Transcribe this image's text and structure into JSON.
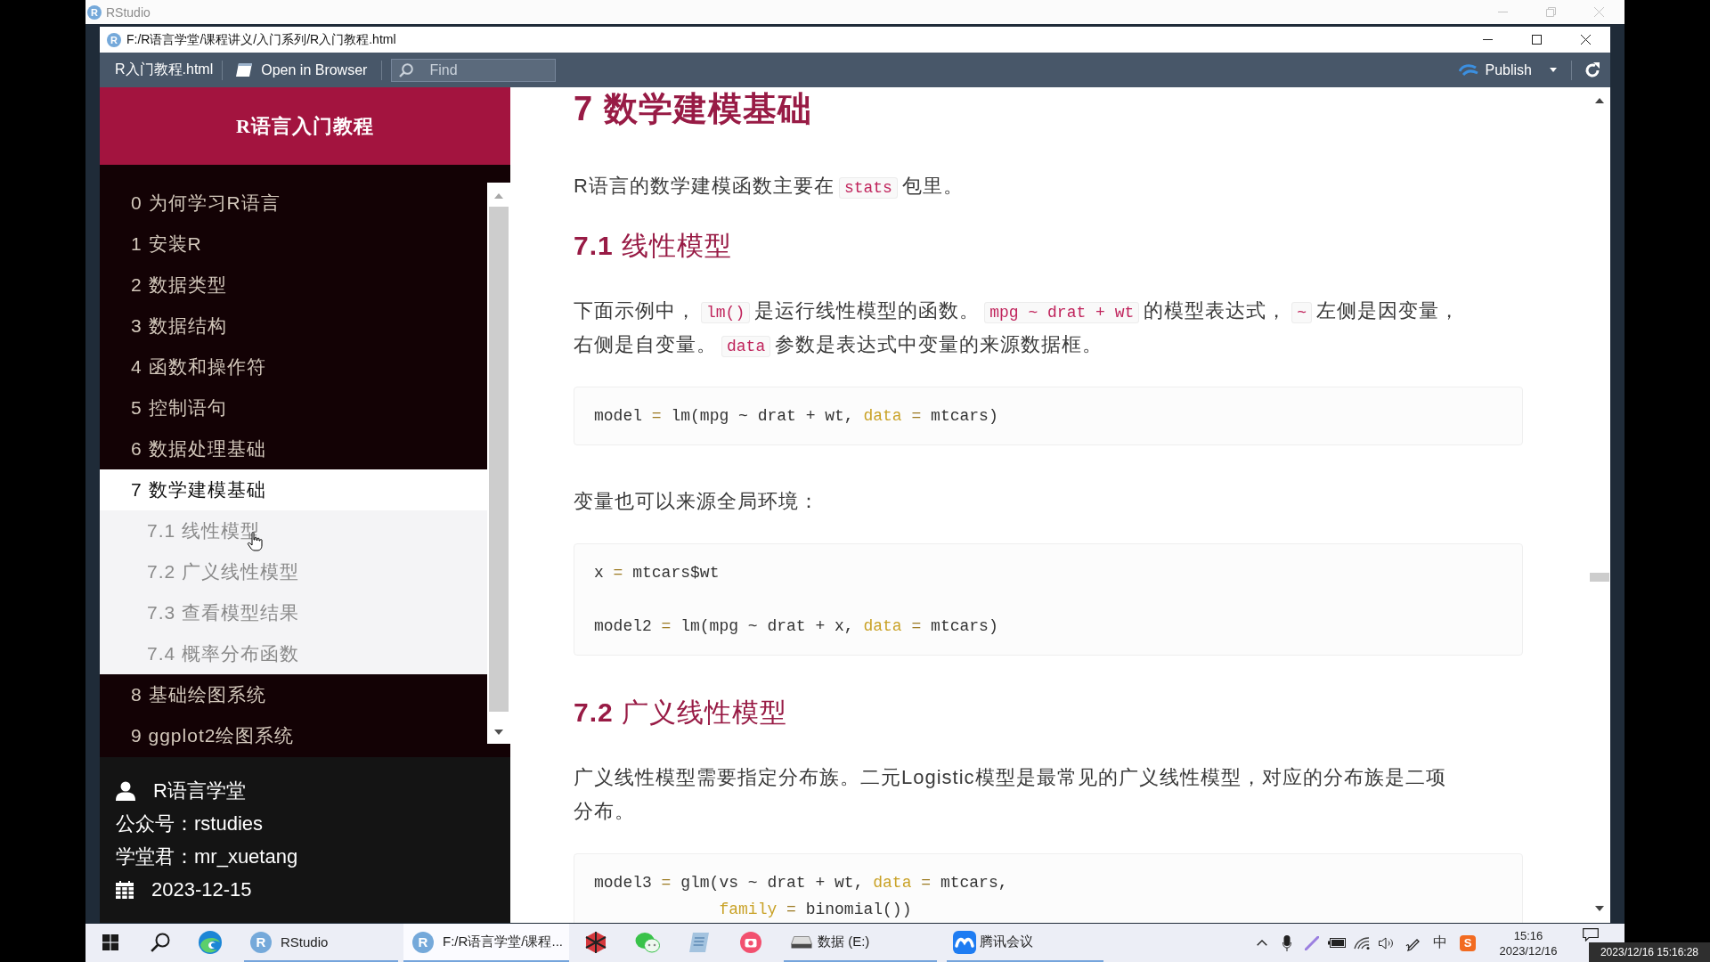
{
  "outer_window": {
    "logo_letter": "R",
    "title": "RStudio"
  },
  "viewer": {
    "logo_letter": "R",
    "title": "F:/R语言学堂/课程讲义/入门系列/R入门教程.html",
    "toolbar": {
      "file_label": "R入门教程.html",
      "open_button": "Open in Browser",
      "find": {
        "placeholder": "Find"
      },
      "publish_button": "Publish"
    }
  },
  "sidebar": {
    "title": "R语言入门教程",
    "items": [
      {
        "label": "0 为何学习R语言",
        "selected": false
      },
      {
        "label": "1 安装R",
        "selected": false
      },
      {
        "label": "2 数据类型",
        "selected": false
      },
      {
        "label": "3 数据结构",
        "selected": false
      },
      {
        "label": "4 函数和操作符",
        "selected": false
      },
      {
        "label": "5 控制语句",
        "selected": false
      },
      {
        "label": "6 数据处理基础",
        "selected": false
      },
      {
        "label": "7 数学建模基础",
        "selected": true,
        "children": [
          {
            "label": "7.1 线性模型",
            "selected": false,
            "hovered": true
          },
          {
            "label": "7.2 广义线性模型",
            "selected": false,
            "hovered": false
          },
          {
            "label": "7.3 查看模型结果",
            "selected": false,
            "hovered": false
          },
          {
            "label": "7.4 概率分布函数",
            "selected": false,
            "hovered": false
          }
        ]
      },
      {
        "label": "8 基础绘图系统",
        "selected": false
      },
      {
        "label": "9 ggplot2绘图系统",
        "selected": false
      }
    ],
    "footer": [
      {
        "kind": "person",
        "text": "R语言学堂"
      },
      {
        "kind": "plain",
        "text": "公众号：rstudies"
      },
      {
        "kind": "plain",
        "text": "学堂君：mr_xuetang"
      },
      {
        "kind": "calendar",
        "text": "2023-12-15"
      }
    ]
  },
  "content": [
    {
      "kind": "h1",
      "text": "7 数学建模基础"
    },
    {
      "kind": "paragraph",
      "segments": [
        {
          "kind": "text",
          "text": "R语言的数学建模函数主要在"
        },
        {
          "kind": "code",
          "text": "stats"
        },
        {
          "kind": "text",
          "text": "包里。"
        }
      ]
    },
    {
      "kind": "h2",
      "text": "**7.1** 线性模型"
    },
    {
      "kind": "paragraph",
      "segments": [
        {
          "kind": "text",
          "text": "下面示例中，"
        },
        {
          "kind": "code",
          "text": "lm()"
        },
        {
          "kind": "text",
          "text": "是运行线性模型的函数。"
        },
        {
          "kind": "code",
          "text": "mpg ~ drat + wt"
        },
        {
          "kind": "text",
          "text": "的模型表达式，"
        },
        {
          "kind": "code",
          "text": "~"
        },
        {
          "kind": "text",
          "text": "左侧是因变量，右侧是自变量。"
        },
        {
          "kind": "code",
          "text": "data"
        },
        {
          "kind": "text",
          "text": "参数是表达式中变量的来源数据框。"
        }
      ]
    },
    {
      "kind": "code",
      "groups": [
        {
          "lines": [
            {
              "tokens": [
                {
                  "kind": "plain",
                  "text": "model"
                },
                {
                  "kind": "operator",
                  "text": " = "
                },
                {
                  "kind": "plain",
                  "text": "lm(mpg ~ drat + wt, "
                },
                {
                  "kind": "argument",
                  "text": "data"
                },
                {
                  "kind": "operator",
                  "text": " = "
                },
                {
                  "kind": "plain",
                  "text": "mtcars)"
                }
              ]
            }
          ]
        }
      ]
    },
    {
      "kind": "paragraph",
      "segments": [
        {
          "kind": "text",
          "text": "变量也可以来源全局环境："
        }
      ]
    },
    {
      "kind": "code",
      "groups": [
        {
          "lines": [
            {
              "tokens": [
                {
                  "kind": "plain",
                  "text": "x"
                },
                {
                  "kind": "operator",
                  "text": " = "
                },
                {
                  "kind": "plain",
                  "text": "mtcars$wt"
                }
              ]
            }
          ]
        },
        {
          "lines": [
            {
              "tokens": [
                {
                  "kind": "plain",
                  "text": "model2"
                },
                {
                  "kind": "operator",
                  "text": " = "
                },
                {
                  "kind": "plain",
                  "text": "lm(mpg ~ drat + x, "
                },
                {
                  "kind": "argument",
                  "text": "data"
                },
                {
                  "kind": "operator",
                  "text": " = "
                },
                {
                  "kind": "plain",
                  "text": "mtcars)"
                }
              ]
            }
          ]
        }
      ]
    },
    {
      "kind": "h2",
      "text": "**7.2** 广义线性模型"
    },
    {
      "kind": "paragraph",
      "segments": [
        {
          "kind": "text",
          "text": "广义线性模型需要指定分布族。二元Logistic模型是最常见的广义线性模型，对应的分布族是二项分布。"
        }
      ]
    },
    {
      "kind": "code",
      "groups": [
        {
          "lines": [
            {
              "tokens": [
                {
                  "kind": "plain",
                  "text": "model3"
                },
                {
                  "kind": "operator",
                  "text": " = "
                },
                {
                  "kind": "plain",
                  "text": "glm(vs ~ drat + wt, "
                },
                {
                  "kind": "argument",
                  "text": "data"
                },
                {
                  "kind": "operator",
                  "text": " = "
                },
                {
                  "kind": "plain",
                  "text": "mtcars,"
                }
              ]
            },
            {
              "tokens": [
                {
                  "kind": "argument",
                  "text": "             family"
                },
                {
                  "kind": "operator",
                  "text": " = "
                },
                {
                  "kind": "plain",
                  "text": "binomial())"
                }
              ]
            }
          ]
        }
      ]
    }
  ],
  "taskbar": {
    "items": [
      {
        "kind": "start",
        "selected": false,
        "running": false
      },
      {
        "kind": "search",
        "selected": false,
        "running": false
      },
      {
        "kind": "browser",
        "selected": false,
        "running": false
      },
      {
        "kind": "rstudio",
        "logo_letter": "R",
        "label": "RStudio",
        "selected": false,
        "running": true
      },
      {
        "kind": "rstudio",
        "logo_letter": "R",
        "label": "F:/R语言学堂/课程...",
        "selected": true,
        "running": true
      },
      {
        "kind": "cube",
        "selected": false,
        "running": false
      },
      {
        "kind": "chat",
        "selected": false,
        "running": false
      },
      {
        "kind": "notepad",
        "selected": false,
        "running": false
      },
      {
        "kind": "camera",
        "selected": false,
        "running": false
      },
      {
        "kind": "drive",
        "label": "数据 (E:)",
        "selected": false,
        "running": true
      },
      {
        "kind": "meeting",
        "label": "腾讯会议",
        "selected": false,
        "running": true
      }
    ],
    "tray": {
      "ime_mode": "中",
      "ime_logo": "S",
      "time": "15:16",
      "date": "2023/12/16"
    }
  },
  "recording_timestamp": "2023/12/16 15:16:28"
}
